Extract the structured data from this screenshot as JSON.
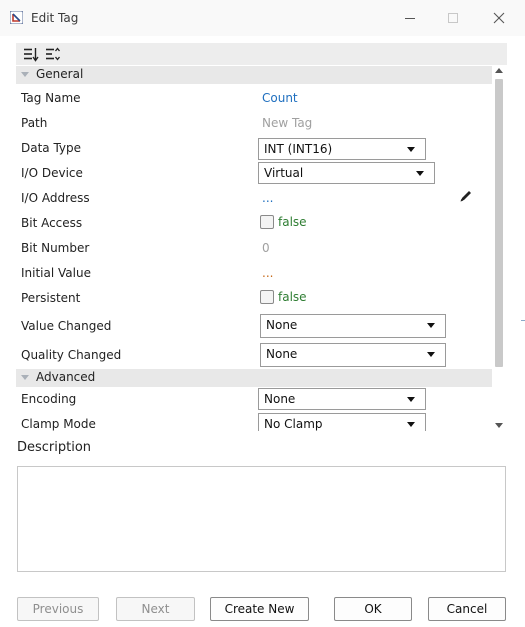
{
  "window": {
    "title": "Edit Tag"
  },
  "toolbar": {
    "sort_icon": "sort-alphabetical-icon",
    "categorize_icon": "categorize-icon"
  },
  "categories": {
    "general": {
      "label": "General"
    },
    "advanced": {
      "label": "Advanced"
    }
  },
  "properties": {
    "tag_name": {
      "label": "Tag Name",
      "value": "Count"
    },
    "path": {
      "label": "Path",
      "value": "New Tag"
    },
    "data_type": {
      "label": "Data Type",
      "value": "INT (INT16)"
    },
    "io_device": {
      "label": "I/O Device",
      "value": "Virtual"
    },
    "io_address": {
      "label": "I/O Address",
      "value": "..."
    },
    "bit_access": {
      "label": "Bit Access",
      "value": "false"
    },
    "bit_number": {
      "label": "Bit Number",
      "value": "0"
    },
    "initial_value": {
      "label": "Initial Value",
      "value": "..."
    },
    "persistent": {
      "label": "Persistent",
      "value": "false"
    },
    "value_changed": {
      "label": "Value Changed",
      "value": "None"
    },
    "quality_changed": {
      "label": "Quality Changed",
      "value": "None"
    },
    "encoding": {
      "label": "Encoding",
      "value": "None"
    },
    "clamp_mode": {
      "label": "Clamp Mode",
      "value": "No Clamp"
    }
  },
  "description": {
    "label": "Description",
    "value": ""
  },
  "buttons": {
    "previous": "Previous",
    "next": "Next",
    "create_new": "Create New",
    "ok": "OK",
    "cancel": "Cancel"
  },
  "colors": {
    "link_blue": "#1f6fbf",
    "false_green": "#2e7d32",
    "ellipsis_orange": "#c76a1a",
    "category_bg": "#e8e8e8"
  }
}
